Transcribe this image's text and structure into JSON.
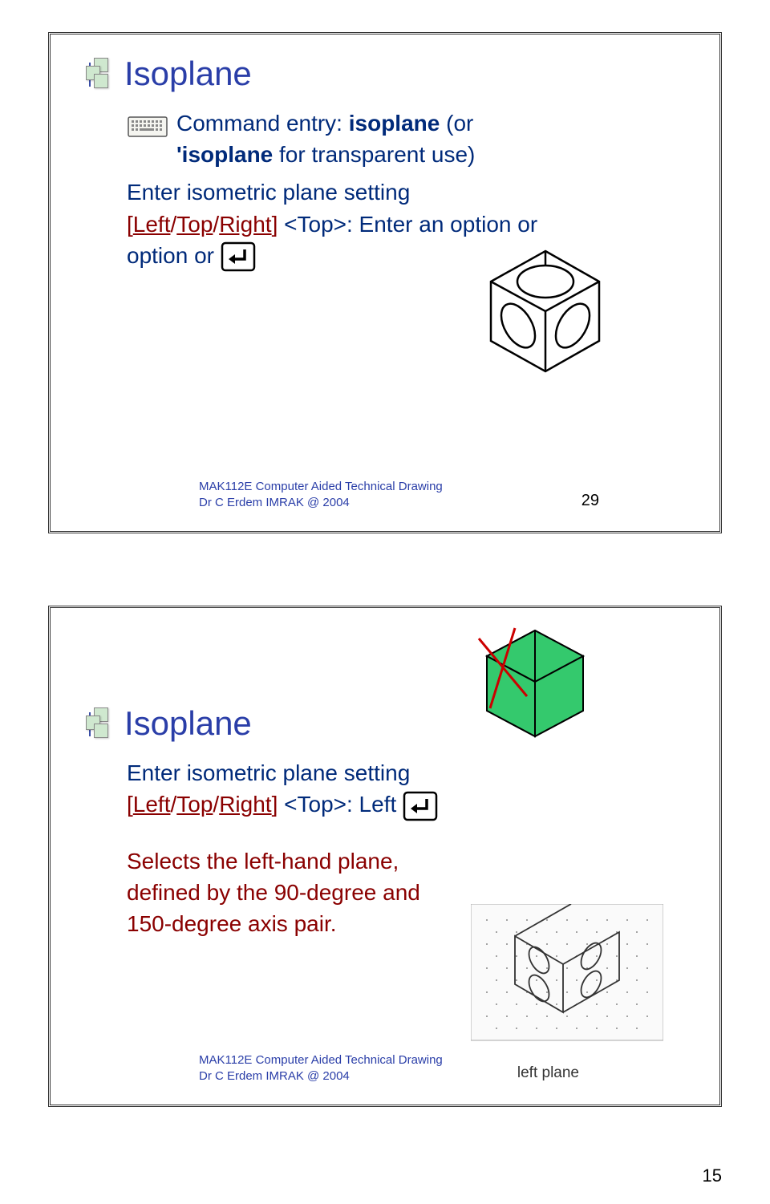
{
  "page_number": "15",
  "slide1": {
    "title": "Isoplane",
    "command_label": "Command entry: ",
    "command_name": "isoplane",
    "command_suffix": " (or ",
    "command_alt": "'isoplane",
    "command_suffix2": " for transparent use)",
    "line2a": "Enter isometric plane setting ",
    "bracket_open": "[",
    "opt_left": "Left",
    "slash": "/",
    "opt_top": "Top",
    "opt_right": "Right",
    "bracket_close": "]",
    "top_label": " <Top>: Enter an option or",
    "footer1": "MAK112E Computer Aided Technical Drawing",
    "footer2": "Dr C Erdem IMRAK @ 2004",
    "slide_num": "29"
  },
  "slide2": {
    "title": "Isoplane",
    "line1": "Enter isometric plane setting",
    "bracket_open": "[",
    "opt_left": "Left",
    "slash": "/",
    "opt_top": "Top",
    "opt_right": "Right",
    "bracket_close": "]",
    "top_label": " <Top>: Left",
    "desc1": "Selects the left-hand plane, defined by the 90-degree and 150-degree axis pair.",
    "footer1": "MAK112E Computer Aided Technical Drawing",
    "footer2": "Dr C Erdem IMRAK @ 2004",
    "plane_label": "left plane"
  }
}
